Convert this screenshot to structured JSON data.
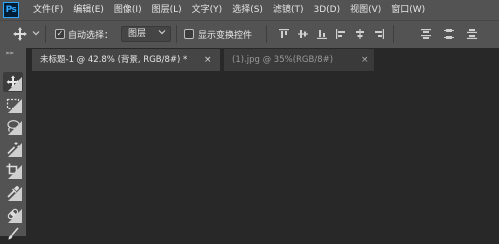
{
  "app": {
    "logo": "Ps"
  },
  "menu": [
    "文件(F)",
    "编辑(E)",
    "图像(I)",
    "图层(L)",
    "文字(Y)",
    "选择(S)",
    "滤镜(T)",
    "3D(D)",
    "视图(V)",
    "窗口(W)"
  ],
  "options": {
    "tool_icon": "move-tool-icon",
    "auto_select_label": "自动选择：",
    "auto_select_checked": true,
    "auto_select_target": "图层",
    "show_transform_label": "显示变换控件",
    "show_transform_checked": false,
    "align_icons": [
      "align-top-edges-icon",
      "align-vertical-centers-icon",
      "align-bottom-edges-icon",
      "align-left-edges-icon",
      "align-horizontal-centers-icon",
      "align-right-edges-icon",
      "distribute-top-edges-icon",
      "distribute-vertical-centers-icon",
      "distribute-bottom-edges-icon"
    ]
  },
  "tabs": [
    {
      "label": "未标题-1 @ 42.8% (背景, RGB/8#) *",
      "active": true,
      "close": "×"
    },
    {
      "label": "(1).jpg @ 35%(RGB/8#)",
      "active": false,
      "close": "×"
    }
  ],
  "tools": [
    {
      "name": "move-tool-icon",
      "active": true
    },
    {
      "name": "rectangular-marquee-tool-icon",
      "active": false
    },
    {
      "name": "lasso-tool-icon",
      "active": false
    },
    {
      "name": "magic-wand-tool-icon",
      "active": false
    },
    {
      "name": "crop-tool-icon",
      "active": false
    },
    {
      "name": "eyedropper-tool-icon",
      "active": false
    },
    {
      "name": "healing-brush-tool-icon",
      "active": false
    },
    {
      "name": "brush-tool-icon",
      "active": false
    }
  ],
  "colors": {
    "chrome": "#535353",
    "canvas": "#282828",
    "active_tab": "#454545",
    "ps_blue": "#31a8ff"
  }
}
